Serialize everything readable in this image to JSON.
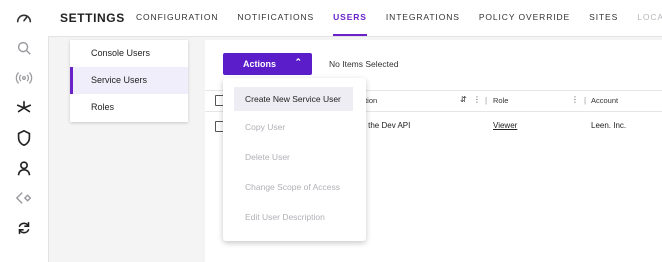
{
  "header": {
    "title": "SETTINGS",
    "tabs": [
      {
        "label": "CONFIGURATION",
        "active": false,
        "disabled": false
      },
      {
        "label": "NOTIFICATIONS",
        "active": false,
        "disabled": false
      },
      {
        "label": "USERS",
        "active": true,
        "disabled": false
      },
      {
        "label": "INTEGRATIONS",
        "active": false,
        "disabled": false
      },
      {
        "label": "POLICY OVERRIDE",
        "active": false,
        "disabled": false
      },
      {
        "label": "SITES",
        "active": false,
        "disabled": false
      },
      {
        "label": "LOCATIONS",
        "active": false,
        "disabled": true
      }
    ]
  },
  "sidebar": {
    "icons": [
      "speedometer-icon",
      "search-icon",
      "broadcast-icon",
      "asterisk-icon",
      "shield-icon",
      "user-icon",
      "diamond-code-icon",
      "sync-icon"
    ]
  },
  "submenu": {
    "items": [
      {
        "label": "Console Users",
        "selected": false
      },
      {
        "label": "Service Users",
        "selected": true
      },
      {
        "label": "Roles",
        "selected": false
      }
    ]
  },
  "toolbar": {
    "actions_label": "Actions",
    "selection_status": "No Items Selected"
  },
  "actions_menu": {
    "items": [
      {
        "label": "Create New Service User",
        "enabled": true,
        "highlighted": true
      },
      {
        "label": "Copy User",
        "enabled": false,
        "highlighted": false
      },
      {
        "label": "Delete User",
        "enabled": false,
        "highlighted": false
      },
      {
        "label": "Change Scope of Access",
        "enabled": false,
        "highlighted": false
      },
      {
        "label": "Edit User Description",
        "enabled": false,
        "highlighted": false
      }
    ]
  },
  "table": {
    "columns": [
      "cription",
      "Role",
      "Account"
    ],
    "rows": [
      {
        "description": "d in the Dev API",
        "role": "Viewer",
        "account": "Leen. Inc."
      }
    ]
  },
  "colors": {
    "accent": "#6b21c8",
    "button": "#5b1cc9",
    "selected_bg": "#efeefa"
  }
}
